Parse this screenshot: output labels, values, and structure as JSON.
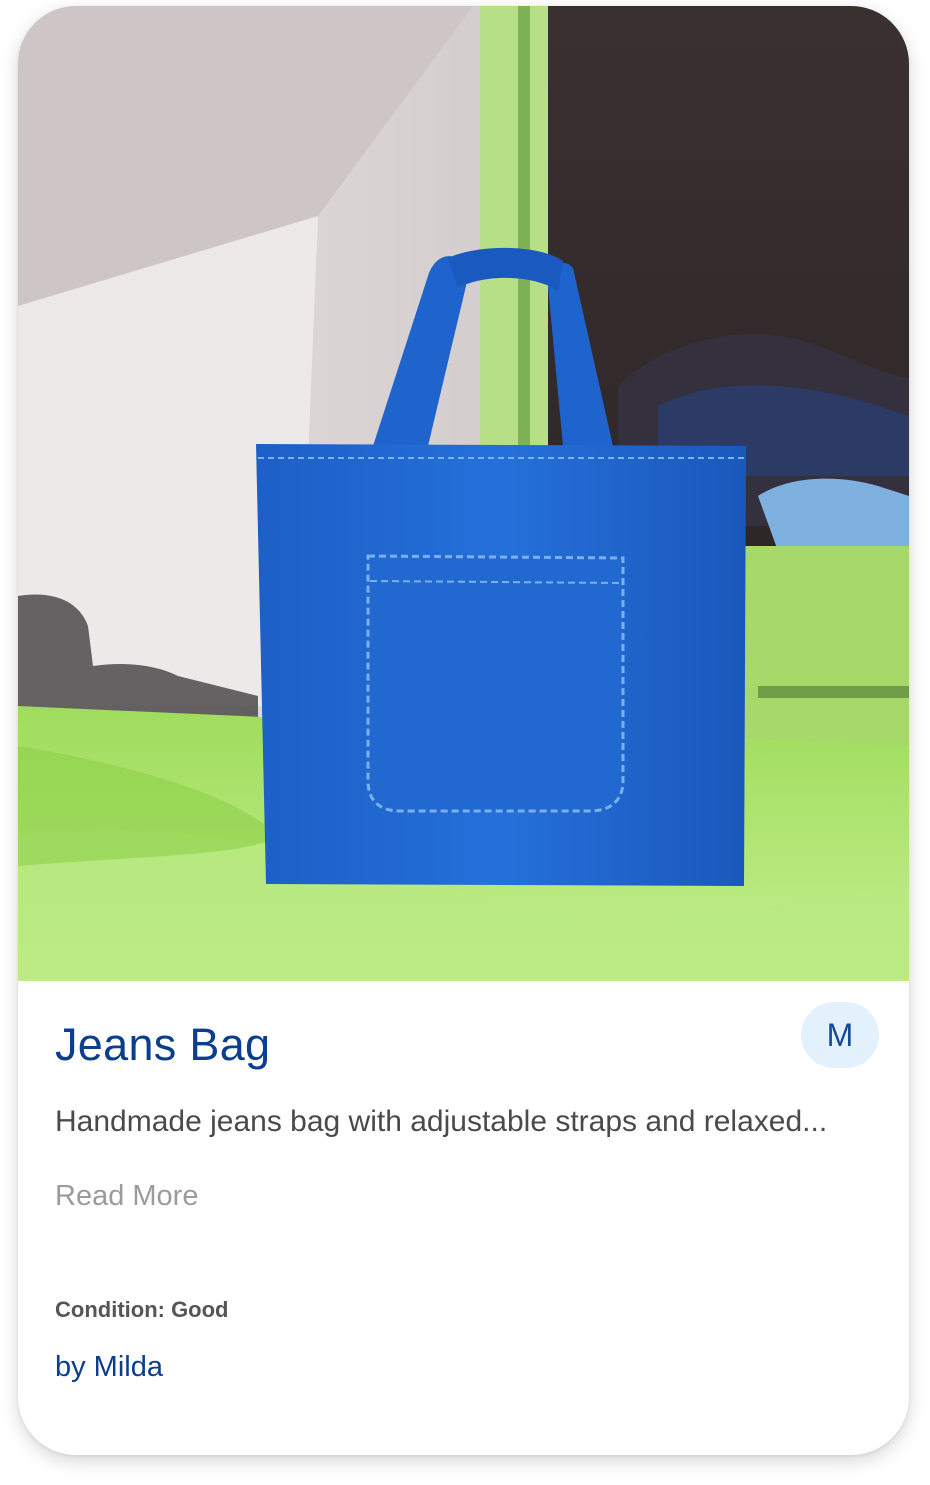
{
  "card": {
    "image_subject": "Jeans Bag",
    "title": "Jeans Bag",
    "avatar_initial": "M",
    "description": "Handmade jeans bag with adjustable straps and relaxed...",
    "read_more_label": "Read More",
    "condition": "Condition: Good",
    "author": "by Milda"
  },
  "colors": {
    "title": "#0c3e8e",
    "avatar_bg": "#e3f1fd",
    "description": "#4a4a4a",
    "read_more": "#9b9b9b",
    "bag_blue": "#1e63cc",
    "background_green": "#a9e067"
  }
}
